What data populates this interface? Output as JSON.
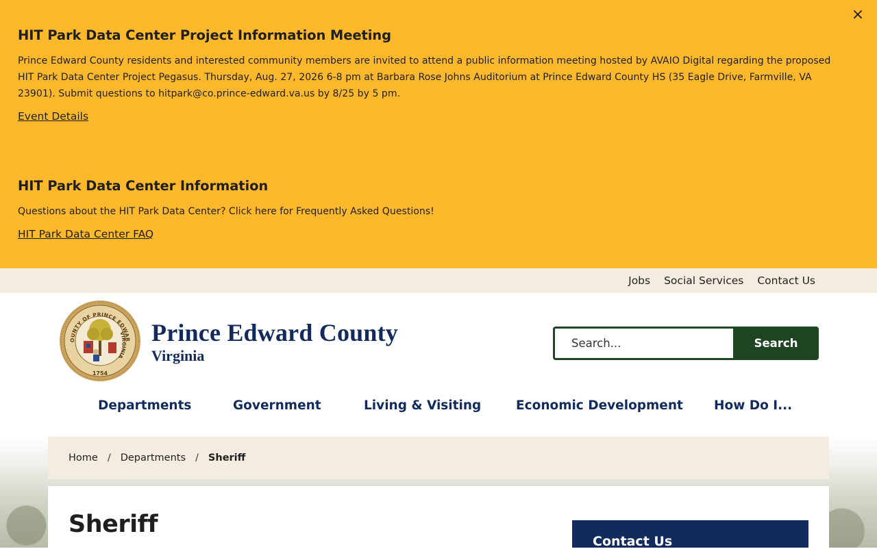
{
  "alert": {
    "close_label": "×",
    "items": [
      {
        "title": "HIT Park Data Center Project Information Meeting",
        "body": "Prince Edward County residents and interested community members are invited to attend a public information meeting hosted by AVAIO Digital regarding the proposed HIT Park Data Center Project Pegasus. Thursday, Aug. 27, 2026 6-8 pm at Barbara Rose Johns Auditorium at Prince Edward County HS (35 Eagle Drive, Farmville, VA 23901). Submit questions to hitpark@co.prince-edward.va.us by 8/25 by 5 pm.",
        "link": "Event Details"
      },
      {
        "title": "HIT Park Data Center Information",
        "body": "Questions about the HIT Park Data Center? Click here for Frequently Asked Questions!",
        "link": "HIT Park Data Center FAQ"
      }
    ]
  },
  "utility_nav": [
    "Jobs",
    "Social Services",
    "Contact Us"
  ],
  "header": {
    "seal_text_top": "COUNTY OF PRINCE EDWARD",
    "seal_text_right": "VIRGINIA",
    "seal_year": "1754",
    "title": "Prince Edward County",
    "subtitle": "Virginia"
  },
  "search": {
    "placeholder": "Search...",
    "button_label": "Search"
  },
  "main_nav": [
    "Departments",
    "Government",
    "Living & Visiting",
    "Economic Development",
    "How Do I..."
  ],
  "breadcrumb": {
    "items": [
      "Home",
      "Departments"
    ],
    "separator": "/",
    "current": "Sheriff"
  },
  "page": {
    "title": "Sheriff",
    "sidebar_heading": "Contact Us"
  },
  "colors": {
    "alert_bg": "#fdb82b",
    "brand_navy": "#122a5c",
    "brand_green": "#1d4522",
    "beige": "#f4ece1"
  }
}
